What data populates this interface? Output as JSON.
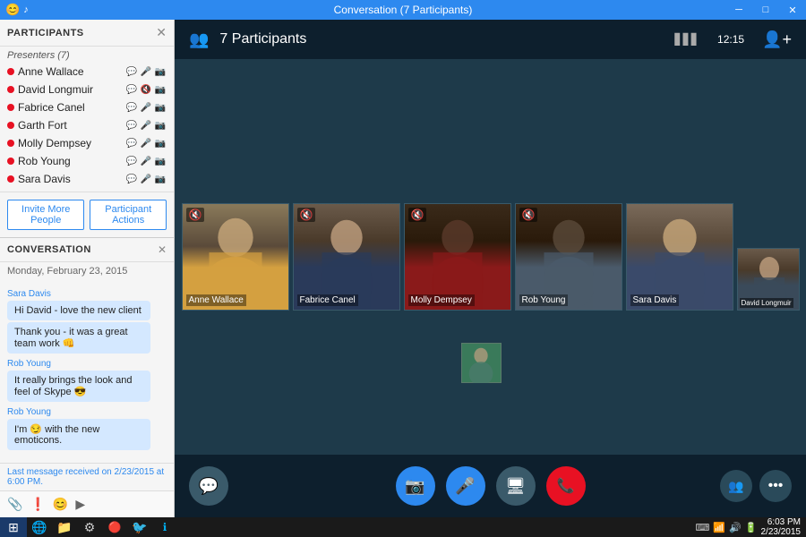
{
  "titlebar": {
    "title": "Conversation (7 Participants)",
    "controls": [
      "emoji",
      "minimize",
      "restore",
      "maximize",
      "close"
    ]
  },
  "left_panel": {
    "participants_title": "PARTICIPANTS",
    "presenters_label": "Presenters (7)",
    "participants": [
      {
        "name": "Anne Wallace",
        "dot_color": "#e81123",
        "icons": [
          "💬",
          "🎤",
          "📷"
        ]
      },
      {
        "name": "David Longmuir",
        "dot_color": "#e81123",
        "icons": [
          "💬",
          "🎤",
          "📷"
        ]
      },
      {
        "name": "Fabrice Canel",
        "dot_color": "#e81123",
        "icons": [
          "💬",
          "🎤",
          "📷"
        ]
      },
      {
        "name": "Garth Fort",
        "dot_color": "#e81123",
        "icons": [
          "💬",
          "🎤",
          "📷"
        ]
      },
      {
        "name": "Molly Dempsey",
        "dot_color": "#e81123",
        "icons": [
          "💬",
          "🎤",
          "📷"
        ]
      },
      {
        "name": "Rob Young",
        "dot_color": "#e81123",
        "icons": [
          "💬",
          "🎤",
          "📷"
        ]
      },
      {
        "name": "Sara Davis",
        "dot_color": "#e81123",
        "icons": [
          "💬",
          "🎤",
          "📷"
        ]
      }
    ],
    "invite_btn": "Invite More People",
    "actions_btn": "Participant Actions",
    "conversation_title": "CONVERSATION",
    "date": "Monday, February 23, 2015",
    "messages": [
      {
        "sender": "Sara Davis",
        "text": "Hi David - love the new client",
        "type": "bubble"
      },
      {
        "sender": "",
        "text": "Thank you - it was a great team work 👊",
        "type": "bubble"
      },
      {
        "sender": "Rob Young",
        "text": "It really brings the look and feel of Skype 😎",
        "type": "bubble"
      },
      {
        "sender": "Rob Young",
        "text": "I'm 😏 with the new emoticons.",
        "type": "bubble"
      }
    ],
    "last_message": "Last message received on 2/23/2015 at 6:00 PM.",
    "chat_icons": [
      "📎",
      "❗",
      "😊",
      "▶"
    ]
  },
  "video_panel": {
    "participants_count": "7 Participants",
    "time": "12:15",
    "signal_bars": "▋▋▋",
    "video_tiles": [
      {
        "name": "Anne Wallace",
        "muted": true,
        "css_class": "person-anne"
      },
      {
        "name": "Fabrice Canel",
        "muted": true,
        "css_class": "person-fabrice"
      },
      {
        "name": "Molly Dempsey",
        "muted": true,
        "css_class": "person-molly"
      },
      {
        "name": "Rob Young",
        "muted": true,
        "css_class": "person-rob"
      },
      {
        "name": "Sara Davis",
        "muted": false,
        "css_class": "person-sara"
      },
      {
        "name": "David Longmuir",
        "muted": false,
        "css_class": "person-david",
        "small": true
      }
    ],
    "controls": {
      "chat": "💬",
      "video": "📷",
      "mic": "🎤",
      "screen": "🖥",
      "hangup": "📞",
      "people": "👥",
      "more": "•••"
    }
  },
  "taskbar": {
    "start_icon": "⊞",
    "apps": [
      "🌐",
      "📁",
      "⚙",
      "🔴",
      "🐦",
      "ℹ"
    ],
    "time": "6:03 PM",
    "date": "2/23/2015",
    "sys_icons": [
      "⌨",
      "📶",
      "🔊"
    ]
  }
}
